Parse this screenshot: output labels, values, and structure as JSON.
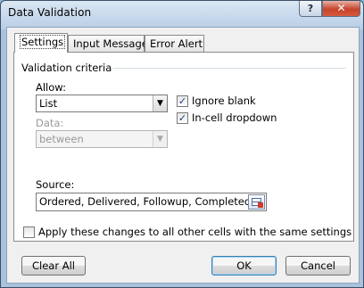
{
  "window": {
    "title": "Data Validation",
    "help_label": "?",
    "close_label": "✕"
  },
  "tabs": [
    {
      "label": "Settings"
    },
    {
      "label": "Input Message"
    },
    {
      "label": "Error Alert"
    }
  ],
  "settings": {
    "group_label": "Validation criteria",
    "allow_label": "Allow:",
    "allow_value": "List",
    "data_label": "Data:",
    "data_value": "between",
    "ignore_blank_label": "Ignore blank",
    "ignore_blank_checked": true,
    "in_cell_dropdown_label": "In-cell dropdown",
    "in_cell_dropdown_checked": true,
    "source_label": "Source:",
    "source_value": "Ordered, Delivered, Followup, Completed",
    "apply_all_label": "Apply these changes to all other cells with the same settings",
    "apply_all_checked": false
  },
  "buttons": {
    "clear_all": "Clear All",
    "ok": "OK",
    "cancel": "Cancel"
  },
  "icons": {
    "dropdown": "▼",
    "check": "✓"
  }
}
